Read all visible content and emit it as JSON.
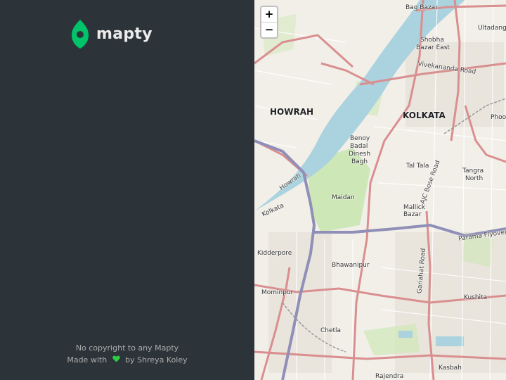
{
  "sidebar": {
    "logo_text": "mapty",
    "footer_line1": "No copyright to any Mapty",
    "footer_made_with": "Made with",
    "footer_by": "by Shreya Koley"
  },
  "map": {
    "zoom_in": "+",
    "zoom_out": "−",
    "labels": {
      "bag_bazar": "Bag Bazar",
      "ultadanga": "Ultadang",
      "shobha": "Shobha",
      "bazar_east": "Bazar East",
      "vivekananda": "Vivekananda Road",
      "howrah_big": "HOWRAH",
      "kolkata_big": "KOLKATA",
      "phool": "Phool",
      "benoy": "Benoy",
      "badal": "Badal",
      "dinesh": "Dinesh",
      "bagh": "Bagh",
      "tal_tala": "Tal Tala",
      "ajc_bose": "AJC Bose Road",
      "tangra": "Tangra",
      "north": "North",
      "howrah_river": "Howrah",
      "maidan": "Maidan",
      "mallick": "Mallick",
      "bazar": "Bazar",
      "parama": "Parama Flyover",
      "kolkata_small": "Kolkata",
      "kidderpore": "Kidderpore",
      "bhawanipur": "Bhawanipur",
      "gariahat": "Gariahat Road",
      "mominpur": "Mominpur",
      "kushita": "Kushita",
      "chetla": "Chetla",
      "kasbah": "Kasbah",
      "rajendra": "Rajendra"
    }
  },
  "colors": {
    "sidebar_bg": "#2d3439",
    "brand_green": "#00c46a",
    "river": "#aad3df",
    "park": "#c8e6b0",
    "major_road": "#d98f8f",
    "flyover": "#8f8fb8"
  }
}
